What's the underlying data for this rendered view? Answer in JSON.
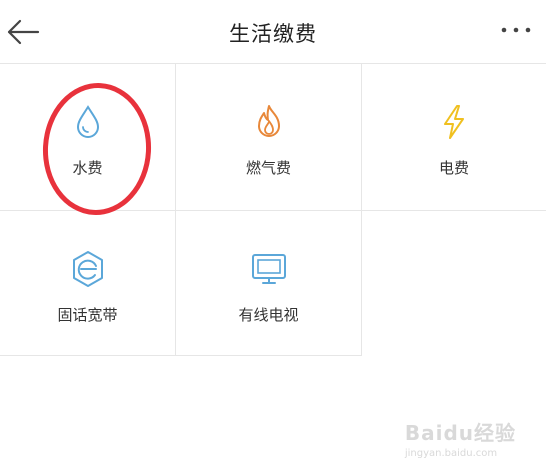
{
  "header": {
    "title": "生活缴费"
  },
  "services": [
    {
      "label": "水费",
      "icon": "water-drop-icon",
      "color": "#5ba7d9"
    },
    {
      "label": "燃气费",
      "icon": "flame-icon",
      "color": "#e8883a"
    },
    {
      "label": "电费",
      "icon": "lightning-icon",
      "color": "#f0c020"
    },
    {
      "label": "固话宽带",
      "icon": "broadband-e-icon",
      "color": "#5ba7d9"
    },
    {
      "label": "有线电视",
      "icon": "tv-icon",
      "color": "#5ba7d9"
    }
  ],
  "annotation_color": "#e8323c",
  "watermark": {
    "text": "Baidu经验",
    "sub": "jingyan.baidu.com"
  }
}
